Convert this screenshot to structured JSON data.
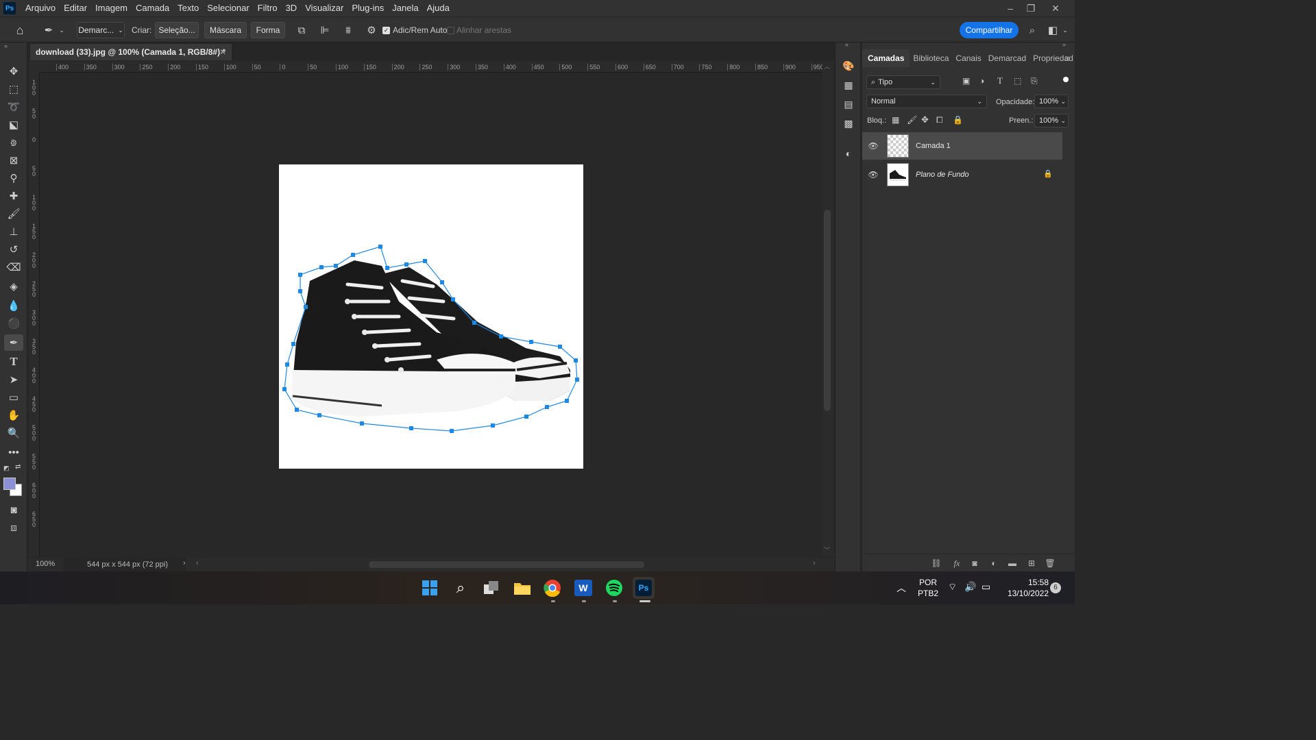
{
  "app": {
    "logo": "Ps"
  },
  "menu": [
    "Arquivo",
    "Editar",
    "Imagem",
    "Camada",
    "Texto",
    "Selecionar",
    "Filtro",
    "3D",
    "Visualizar",
    "Plug-ins",
    "Janela",
    "Ajuda"
  ],
  "window_controls": {
    "minimize": "–",
    "restore": "❐",
    "close": "✕"
  },
  "options": {
    "mode_dropdown": "Demarc...",
    "create_label": "Criar:",
    "selection_button": "Seleção...",
    "mask_button": "Máscara",
    "shape_button": "Forma",
    "auto_add_delete": "Adic/Rem Auto",
    "auto_add_delete_checked": true,
    "align_edges": "Alinhar arestas",
    "share_button": "Compartilhar"
  },
  "document": {
    "tab_title": "download (33).jpg @ 100% (Camada 1, RGB/8#) *",
    "zoom": "100%",
    "size_info": "544 px x 544 px (72 ppi)"
  },
  "ruler": {
    "top_labels": [
      "400",
      "350",
      "300",
      "250",
      "200",
      "150",
      "100",
      "50",
      "0",
      "50",
      "100",
      "150",
      "200",
      "250",
      "300",
      "350",
      "400",
      "450",
      "500",
      "550",
      "600",
      "650",
      "700",
      "750",
      "800",
      "850",
      "900",
      "950"
    ],
    "left_labels": [
      "100",
      "50",
      "0",
      "50",
      "100",
      "150",
      "200",
      "250",
      "300",
      "350",
      "400",
      "450",
      "500",
      "550",
      "600",
      "650"
    ]
  },
  "panel": {
    "tabs": [
      "Camadas",
      "Biblioteca",
      "Canais",
      "Demarcad",
      "Propriedad"
    ],
    "filter_label": "Tipo",
    "blend_mode": "Normal",
    "opacity_label": "Opacidade:",
    "opacity_value": "100%",
    "lock_label": "Bloq.:",
    "fill_label": "Preen.:",
    "fill_value": "100%",
    "layers": [
      {
        "name": "Camada 1",
        "visible": true,
        "selected": true,
        "locked": false
      },
      {
        "name": "Plano de Fundo",
        "visible": true,
        "selected": false,
        "locked": true
      }
    ]
  },
  "taskbar": {
    "language": "POR",
    "keyboard": "PTB2",
    "time": "15:58",
    "date": "13/10/2022",
    "notifications": "6"
  },
  "colors": {
    "accent": "#1473e6",
    "path": "#1e88e5",
    "foreground": "#8b8fd6",
    "background": "#ffffff"
  }
}
